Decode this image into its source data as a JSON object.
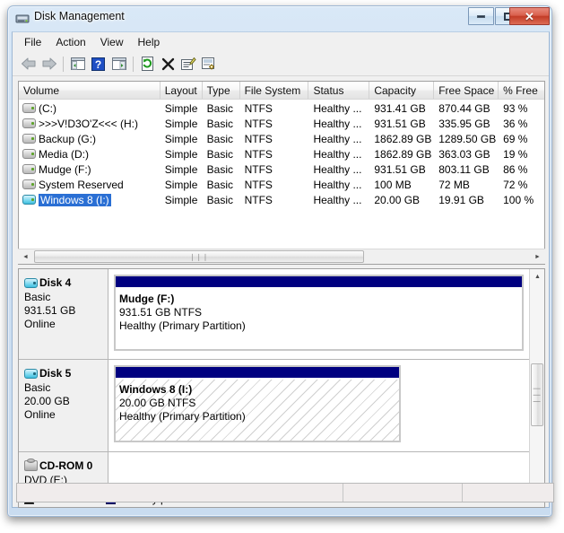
{
  "window": {
    "title": "Disk Management",
    "icon": "disk-management-icon",
    "buttons": {
      "minimize": "minimize-icon",
      "maximize": "maximize-icon",
      "close": "✕"
    }
  },
  "menubar": {
    "items": [
      "File",
      "Action",
      "View",
      "Help"
    ]
  },
  "toolbar": {
    "items": [
      {
        "name": "back-arrow-icon",
        "glyph": "back"
      },
      {
        "name": "forward-arrow-icon",
        "glyph": "forward"
      },
      {
        "name": "separator-1",
        "glyph": "sep"
      },
      {
        "name": "show-hide-console-tree-icon",
        "glyph": "panel-left"
      },
      {
        "name": "help-icon",
        "glyph": "help"
      },
      {
        "name": "show-hide-action-pane-icon",
        "glyph": "panel-right"
      },
      {
        "name": "separator-2",
        "glyph": "sep"
      },
      {
        "name": "refresh-icon",
        "glyph": "refresh"
      },
      {
        "name": "delete-icon",
        "glyph": "delete"
      },
      {
        "name": "properties-icon",
        "glyph": "properties"
      },
      {
        "name": "rescan-disks-icon",
        "glyph": "rescan"
      }
    ]
  },
  "volume_list": {
    "columns": [
      "Volume",
      "Layout",
      "Type",
      "File System",
      "Status",
      "Capacity",
      "Free Space",
      "% Free"
    ],
    "rows": [
      {
        "volume": "(C:)",
        "layout": "Simple",
        "type": "Basic",
        "file_system": "NTFS",
        "status": "Healthy ...",
        "capacity": "931.41 GB",
        "free_space": "870.44 GB",
        "percent_free": "93 %",
        "selected": false
      },
      {
        "volume": ">>>V!D3O'Z<<< (H:)",
        "layout": "Simple",
        "type": "Basic",
        "file_system": "NTFS",
        "status": "Healthy ...",
        "capacity": "931.51 GB",
        "free_space": "335.95 GB",
        "percent_free": "36 %",
        "selected": false
      },
      {
        "volume": "Backup  (G:)",
        "layout": "Simple",
        "type": "Basic",
        "file_system": "NTFS",
        "status": "Healthy ...",
        "capacity": "1862.89 GB",
        "free_space": "1289.50 GB",
        "percent_free": "69 %",
        "selected": false
      },
      {
        "volume": "Media (D:)",
        "layout": "Simple",
        "type": "Basic",
        "file_system": "NTFS",
        "status": "Healthy ...",
        "capacity": "1862.89 GB",
        "free_space": "363.03 GB",
        "percent_free": "19 %",
        "selected": false
      },
      {
        "volume": "Mudge (F:)",
        "layout": "Simple",
        "type": "Basic",
        "file_system": "NTFS",
        "status": "Healthy ...",
        "capacity": "931.51 GB",
        "free_space": "803.11 GB",
        "percent_free": "86 %",
        "selected": false
      },
      {
        "volume": "System Reserved",
        "layout": "Simple",
        "type": "Basic",
        "file_system": "NTFS",
        "status": "Healthy ...",
        "capacity": "100 MB",
        "free_space": "72 MB",
        "percent_free": "72 %",
        "selected": false
      },
      {
        "volume": "Windows 8 (I:)",
        "layout": "Simple",
        "type": "Basic",
        "file_system": "NTFS",
        "status": "Healthy ...",
        "capacity": "20.00 GB",
        "free_space": "19.91 GB",
        "percent_free": "100 %",
        "selected": true
      }
    ]
  },
  "disks": [
    {
      "name": "Disk 4",
      "kind": "disk",
      "type": "Basic",
      "size": "931.51 GB",
      "state": "Online",
      "partitions": [
        {
          "label": "Mudge  (F:)",
          "size_fs": "931.51 GB NTFS",
          "status": "Healthy (Primary Partition)",
          "selected": false
        }
      ]
    },
    {
      "name": "Disk 5",
      "kind": "disk",
      "type": "Basic",
      "size": "20.00 GB",
      "state": "Online",
      "partitions": [
        {
          "label": "Windows 8  (I:)",
          "size_fs": "20.00 GB NTFS",
          "status": "Healthy (Primary Partition)",
          "selected": true
        }
      ]
    },
    {
      "name": "CD-ROM 0",
      "kind": "cdrom",
      "type": "DVD (E:)",
      "size": "",
      "state": "",
      "partitions": []
    }
  ],
  "legend": {
    "items": [
      {
        "label": "Unallocated",
        "color": "#000000"
      },
      {
        "label": "Primary partition",
        "color": "#000080"
      }
    ]
  },
  "statusbar": {
    "cells": [
      "",
      "",
      ""
    ]
  },
  "colors": {
    "partition_bar": "#000080",
    "selection_blue": "#2a6fd4",
    "unallocated": "#000000"
  },
  "scrollbars": {
    "horizontal_grip": "❘❘❘",
    "vertical_grip": "❘❘❘",
    "left_arrow": "◄",
    "right_arrow": "►",
    "up_arrow": "▲",
    "down_arrow": "▼"
  }
}
